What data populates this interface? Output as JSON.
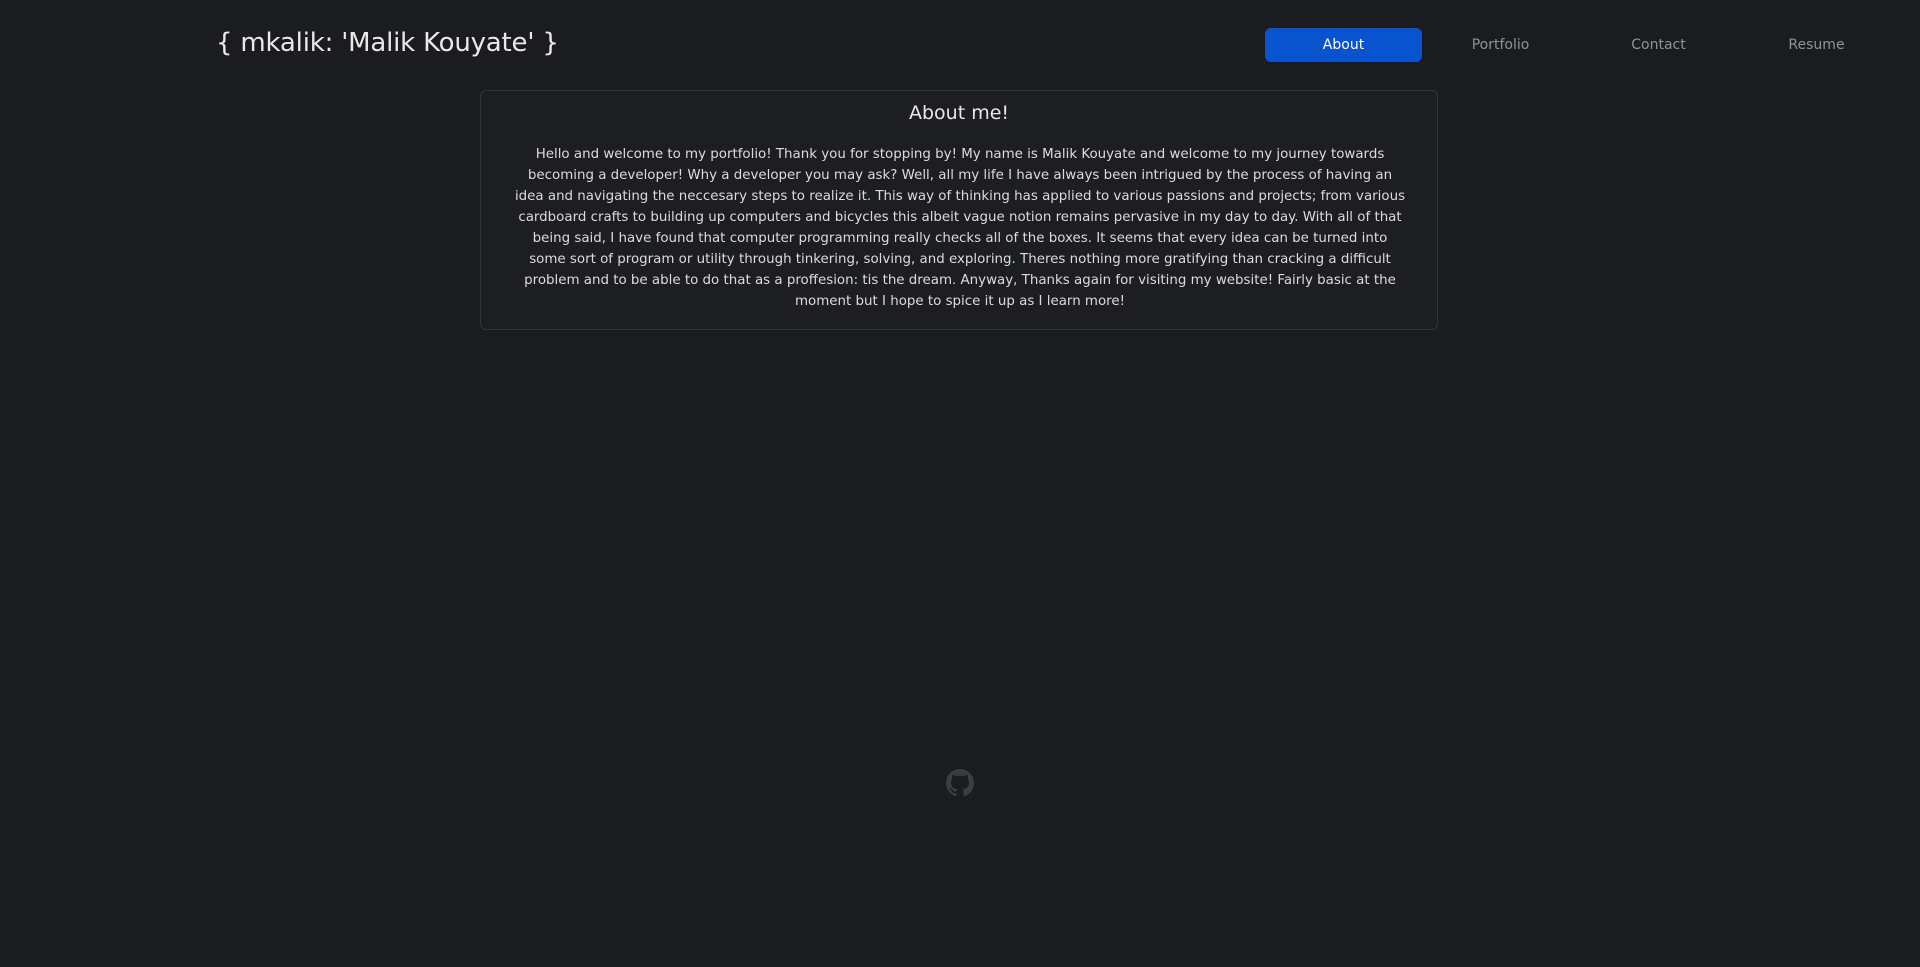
{
  "header": {
    "brand": "{ mkalik: 'Malik Kouyate' }",
    "nav": [
      {
        "label": "About",
        "active": true
      },
      {
        "label": "Portfolio",
        "active": false
      },
      {
        "label": "Contact",
        "active": false
      },
      {
        "label": "Resume",
        "active": false
      }
    ]
  },
  "about": {
    "title": "About me!",
    "body": "Hello and welcome to my portfolio! Thank you for stopping by! My name is Malik Kouyate and welcome to my journey towards becoming a developer! Why a developer you may ask? Well, all my life I have always been intrigued by the process of having an idea and navigating the neccesary steps to realize it. This way of thinking has applied to various passions and projects; from various cardboard crafts to building up computers and bicycles this albeit vague notion remains pervasive in my day to day. With all of that being said, I have found that computer programming really checks all of the boxes. It seems that every idea can be turned into some sort of program or utility through tinkering, solving, and exploring. Theres nothing more gratifying than cracking a difficult problem and to be able to do that as a proffesion: tis the dream. Anyway, Thanks again for visiting my website! Fairly basic at the moment but I hope to spice it up as I learn more!"
  },
  "footer": {
    "icon": "github-icon"
  },
  "colors": {
    "background": "#1a1c1f",
    "accent": "#0a53cf",
    "nav_text": "#8e939a",
    "icon": "#3a3d42"
  }
}
